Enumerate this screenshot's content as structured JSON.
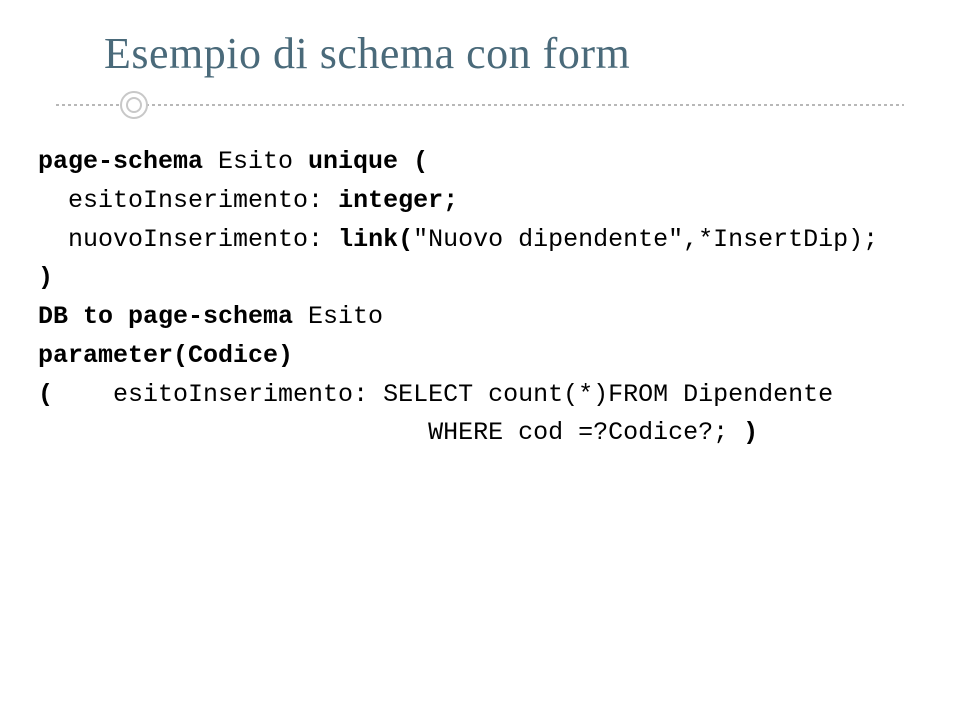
{
  "title": "Esempio di schema con form",
  "code": {
    "l1a": "page-schema ",
    "l1b": "Esito ",
    "l1c": "unique (",
    "l2a": "  esitoInserimento: ",
    "l2b": "integer;",
    "l3a": "  nuovoInserimento: ",
    "l3b": "link(",
    "l3c": "\"Nuovo dipendente\",*InsertDip);",
    "l4": ")",
    "l5a": "DB to page-schema ",
    "l5b": "Esito",
    "l6": "parameter(Codice)",
    "l7a": "(",
    "l7b": "    esitoInserimento: SELECT count(*)FROM Dipendente",
    "l8a": "                          WHERE cod =?Codice?; ",
    "l8b": ")"
  }
}
